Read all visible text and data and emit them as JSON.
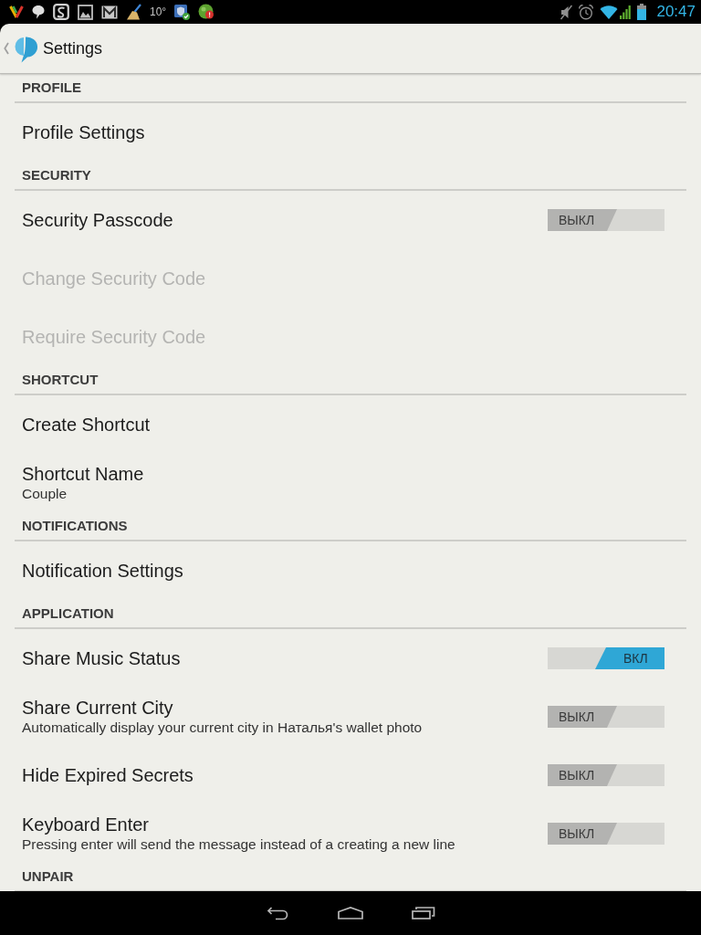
{
  "status_bar": {
    "temperature": "10°",
    "time": "20:47"
  },
  "action_bar": {
    "title": "Settings"
  },
  "sections": [
    {
      "title": "PROFILE",
      "items": [
        {
          "kind": "plain",
          "title": "Profile Settings",
          "disabled": false
        }
      ]
    },
    {
      "title": "SECURITY",
      "items": [
        {
          "kind": "switch",
          "title": "Security Passcode",
          "disabled": false,
          "switch": {
            "on": false,
            "label": "ВЫКЛ"
          }
        },
        {
          "kind": "plain",
          "title": "Change Security Code",
          "disabled": true
        },
        {
          "kind": "plain",
          "title": "Require Security Code",
          "disabled": true
        }
      ]
    },
    {
      "title": "SHORTCUT",
      "items": [
        {
          "kind": "plain",
          "title": "Create Shortcut",
          "disabled": false
        },
        {
          "kind": "plain",
          "title": "Shortcut Name",
          "subtitle": "Couple",
          "disabled": false
        }
      ]
    },
    {
      "title": "NOTIFICATIONS",
      "items": [
        {
          "kind": "plain",
          "title": "Notification Settings",
          "disabled": false
        }
      ]
    },
    {
      "title": "APPLICATION",
      "items": [
        {
          "kind": "switch",
          "title": "Share Music Status",
          "disabled": false,
          "switch": {
            "on": true,
            "label": "ВКЛ"
          }
        },
        {
          "kind": "switch",
          "title": "Share Current City",
          "subtitle": "Automatically display your current city in Наталья's wallet photo",
          "disabled": false,
          "switch": {
            "on": false,
            "label": "ВЫКЛ"
          }
        },
        {
          "kind": "switch",
          "title": "Hide Expired Secrets",
          "disabled": false,
          "switch": {
            "on": false,
            "label": "ВЫКЛ"
          }
        },
        {
          "kind": "switch",
          "title": "Keyboard Enter",
          "subtitle": "Pressing enter will send the message instead of a creating a new line",
          "disabled": false,
          "switch": {
            "on": false,
            "label": "ВЫКЛ"
          }
        }
      ]
    },
    {
      "title": "UNPAIR"
    }
  ]
}
